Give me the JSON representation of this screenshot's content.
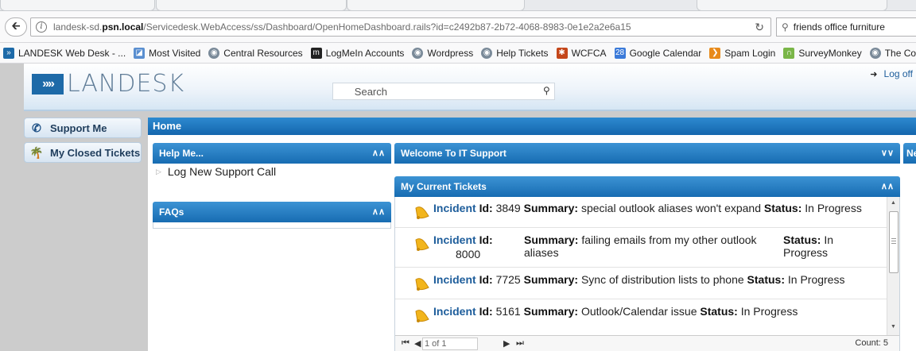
{
  "browser": {
    "url_prefix": "landesk-sd.",
    "url_host": "psn.local",
    "url_path": "/Servicedesk.WebAccess/ss/Dashboard/OpenHomeDashboard.rails?id=c2492b87-2b72-4068-8983-0e1e2a2e6a15",
    "search_value": "friends office furniture",
    "bookmarks": [
      {
        "label": "LANDESK Web Desk - ...",
        "icon": "landesk-icon",
        "color": "#1d6aa8"
      },
      {
        "label": "Most Visited",
        "icon": "folder-icon",
        "color": "#5a8fd0"
      },
      {
        "label": "Central Resources",
        "icon": "globe-icon",
        "color": "#7a8a99"
      },
      {
        "label": "LogMeIn Accounts",
        "icon": "logmein-icon",
        "color": "#222222"
      },
      {
        "label": "Wordpress",
        "icon": "globe-icon",
        "color": "#7a8a99"
      },
      {
        "label": "Help Tickets",
        "icon": "globe-icon",
        "color": "#7a8a99"
      },
      {
        "label": "WCFCA",
        "icon": "wcfca-icon",
        "color": "#c4461a"
      },
      {
        "label": "Google Calendar",
        "icon": "calendar-icon",
        "color": "#3b7ad9"
      },
      {
        "label": "Spam Login",
        "icon": "arrow-icon",
        "color": "#e88a1a"
      },
      {
        "label": "SurveyMonkey",
        "icon": "surveymonkey-icon",
        "color": "#7ab648"
      },
      {
        "label": "The Co",
        "icon": "globe-icon",
        "color": "#7a8a99"
      }
    ]
  },
  "app": {
    "logo_text": "LANDESK",
    "logo_mark": "»»",
    "search_placeholder": "Search",
    "logoff_label": "Log off",
    "home_title": "Home",
    "sidebar": [
      {
        "label": "Support Me",
        "icon": "phone-icon"
      },
      {
        "label": "My Closed Tickets",
        "icon": "palm-tree-icon"
      }
    ],
    "help_panel": {
      "title": "Help Me...",
      "item": "Log New Support Call"
    },
    "faq_panel": {
      "title": "FAQs"
    },
    "welcome_panel": {
      "title": "Welcome To IT Support"
    },
    "right_panel": {
      "title": "Ne"
    },
    "tickets_panel": {
      "title": "My Current Tickets",
      "labels": {
        "incident": "Incident",
        "id": "Id:",
        "summary": "Summary:",
        "status": "Status:"
      },
      "tickets": [
        {
          "id": "3849",
          "summary": "special outlook aliases won't expand",
          "status": "In Progress"
        },
        {
          "id": "8000",
          "summary": "failing emails from my other outlook aliases",
          "status": "In Progress"
        },
        {
          "id": "7725",
          "summary": "Sync of distribution lists to phone",
          "status": "In Progress"
        },
        {
          "id": "5161",
          "summary": "Outlook/Calendar issue",
          "status": "In Progress"
        }
      ],
      "pager": {
        "page_text": "1 of 1",
        "count_text": "Count: 5"
      }
    },
    "colors": {
      "header_blue": "#1466ad",
      "link_blue": "#1d5d9b",
      "bell_yellow": "#f2b51c"
    }
  }
}
